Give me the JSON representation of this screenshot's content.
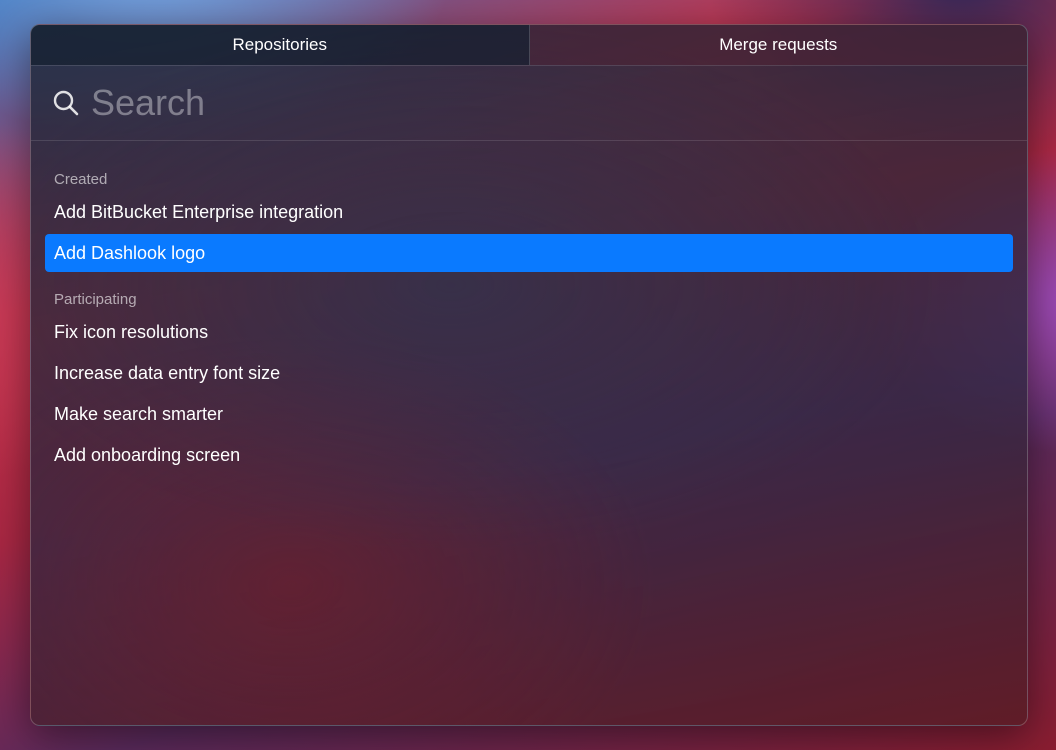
{
  "tabs": [
    {
      "label": "Repositories",
      "active": true
    },
    {
      "label": "Merge requests",
      "active": false
    }
  ],
  "search": {
    "icon": "search-icon",
    "placeholder": "Search",
    "value": ""
  },
  "sections": [
    {
      "label": "Created",
      "items": [
        {
          "label": "Add BitBucket Enterprise integration",
          "selected": false
        },
        {
          "label": "Add Dashlook logo",
          "selected": true
        }
      ]
    },
    {
      "label": "Participating",
      "items": [
        {
          "label": "Fix icon resolutions",
          "selected": false
        },
        {
          "label": "Increase data entry font size",
          "selected": false
        },
        {
          "label": "Make search smarter",
          "selected": false
        },
        {
          "label": "Add onboarding screen",
          "selected": false
        }
      ]
    }
  ],
  "colors": {
    "selection": "#0a7aff"
  }
}
